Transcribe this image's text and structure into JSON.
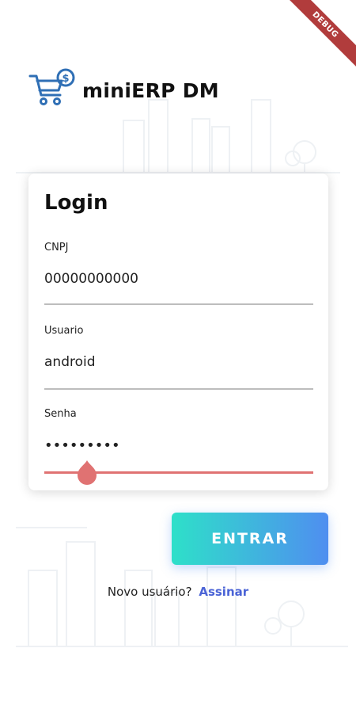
{
  "debug_banner": "DEBUG",
  "app": {
    "name": "miniERP DM"
  },
  "login": {
    "title": "Login",
    "fields": [
      {
        "label": "CNPJ",
        "value": "00000000000"
      },
      {
        "label": "Usuario",
        "value": "android"
      },
      {
        "label": "Senha",
        "value": "•••••••••"
      }
    ],
    "password_slider_value": 0.16
  },
  "actions": {
    "submit_label": "ENTRAR",
    "signup_prompt": "Novo usuário?",
    "signup_link": "Assinar"
  },
  "colors": {
    "gradient_start": "#2ee0c9",
    "gradient_end": "#4f8ef0",
    "link": "#4a63d6",
    "slider": "#e07272",
    "debug_ribbon": "#b13c3c",
    "logo_blue": "#2f6fb5"
  }
}
